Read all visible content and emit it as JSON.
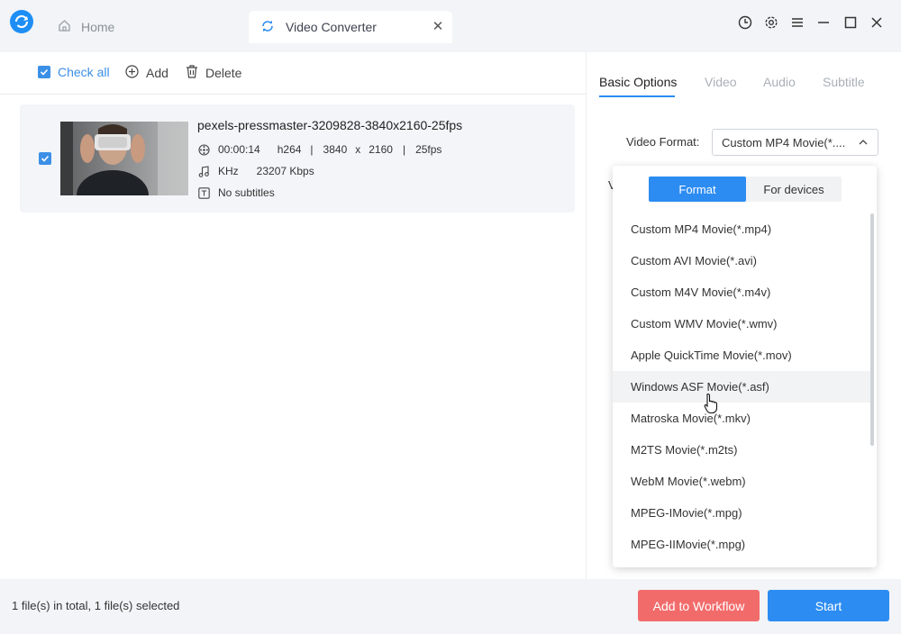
{
  "app": {
    "tabs": {
      "home": "Home",
      "active": "Video Converter"
    }
  },
  "toolbar": {
    "check_all": "Check all",
    "add": "Add",
    "delete": "Delete"
  },
  "file": {
    "name": "pexels-pressmaster-3209828-3840x2160-25fps",
    "duration": "00:00:14",
    "codec": "h264",
    "width": "3840",
    "x": "x",
    "height": "2160",
    "fps": "25fps",
    "sep": "|",
    "audio_rate": "KHz",
    "bitrate": "23207 Kbps",
    "subtitles": "No subtitles",
    "checked": true
  },
  "right_panel": {
    "tabs": [
      "Basic Options",
      "Video",
      "Audio",
      "Subtitle"
    ],
    "active_tab": "Basic Options",
    "video_format_label": "Video Format:",
    "video_format_value": "Custom MP4 Movie(*....",
    "partial_label": "V"
  },
  "dropdown": {
    "segments": [
      "Format",
      "For devices"
    ],
    "active_segment": "Format",
    "options": [
      "Custom MP4 Movie(*.mp4)",
      "Custom AVI Movie(*.avi)",
      "Custom M4V Movie(*.m4v)",
      "Custom WMV Movie(*.wmv)",
      "Apple QuickTime Movie(*.mov)",
      "Windows ASF Movie(*.asf)",
      "Matroska Movie(*.mkv)",
      "M2TS Movie(*.m2ts)",
      "WebM Movie(*.webm)",
      "MPEG-IMovie(*.mpg)",
      "MPEG-IIMovie(*.mpg)"
    ],
    "hovered": "Windows ASF Movie(*.asf)"
  },
  "footer": {
    "status": "1 file(s) in total, 1 file(s) selected",
    "add_to_workflow": "Add to Workflow",
    "start": "Start"
  },
  "colors": {
    "accent": "#2c8cf2",
    "danger": "#f26b6b",
    "background": "#f2f4f7"
  }
}
